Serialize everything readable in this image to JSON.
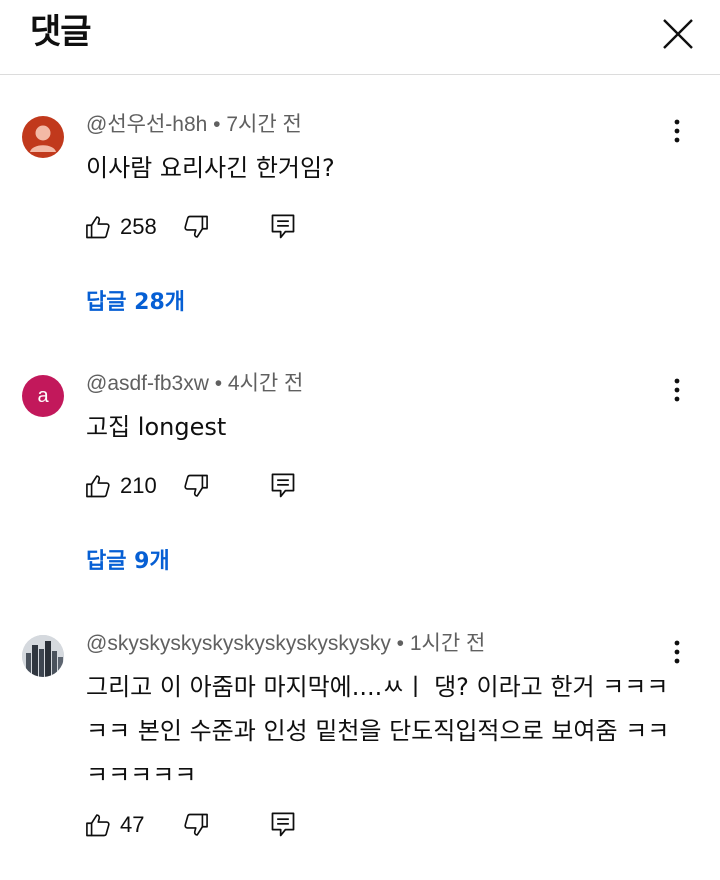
{
  "header": {
    "title": "댓글"
  },
  "comments": [
    {
      "author": "@선우선-h8h",
      "time": "7시간 전",
      "text": "이사람 요리사긴 한거임?",
      "likes": "258",
      "replies_label": "답글 28개",
      "avatar_color": "#c1391c"
    },
    {
      "author": "@asdf-fb3xw",
      "time": "4시간 전",
      "text": "고집 longest",
      "likes": "210",
      "replies_label": "답글 9개",
      "avatar_letter": "a",
      "avatar_color": "#c2185b"
    },
    {
      "author": "@skyskyskyskyskyskyskyskysky",
      "time": "1시간 전",
      "text": "그리고 이 아줌마 마지막에....ㅆㅣ 댕? 이라고 한거 ㅋㅋㅋㅋㅋ 본인 수준과 인성 밑천을 단도직입적으로 보여줌 ㅋㅋㅋㅋㅋㅋㅋ",
      "likes": "47",
      "avatar_color": "#5a6470"
    }
  ],
  "colors": {
    "link": "#065fd4",
    "meta": "#606060"
  }
}
